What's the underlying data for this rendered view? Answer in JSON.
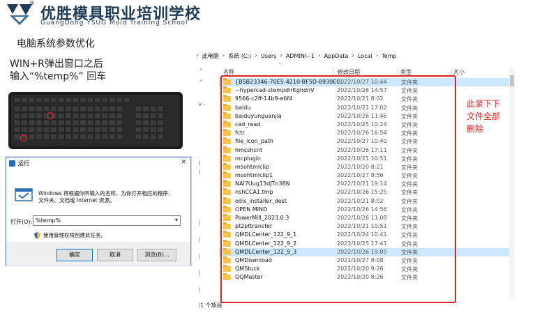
{
  "header": {
    "title": "优胜模具职业培训学校",
    "subtitle": "GuangDong YSUG Mold Training School",
    "registered_mark": "®"
  },
  "slide": {
    "heading": "电脑系统参数优化",
    "instruction_line1": "WIN+R弹出窗口之后",
    "instruction_line2": "输入“%temp%” 回车"
  },
  "run_dialog": {
    "title": "运行",
    "close_glyph": "✕",
    "description_line1": "Windows 将根据你所输入的名称，为你打开相应的程序、",
    "description_line2": "文件夹、文档或 Internet 资源。",
    "open_label": "打开(O):",
    "open_value": "%temp%",
    "admin_text": "使用管理权限创建此任务。",
    "buttons": [
      "确定",
      "取消",
      "浏览(B)..."
    ]
  },
  "explorer": {
    "breadcrumb": [
      "此电脑",
      "系统 (C:)",
      "Users",
      "ADMINI~1",
      "AppData",
      "Local",
      "Temp"
    ],
    "columns": [
      "名称",
      "修改日期",
      "类型",
      "大小"
    ],
    "nav_marks": [
      "^",
      "^",
      "x -",
      "(",
      "(",
      "|",
      "|",
      "|",
      "|",
      "|",
      "|"
    ],
    "files": [
      {
        "name": "{B5B23346-70E5-4210-BF5D-8930EC...",
        "date": "2022/10/27 10:44",
        "type": "文件夹",
        "selected": true
      },
      {
        "name": "~hypercad-stempdirKghdnV",
        "date": "2022/10/26 14:57",
        "type": "文件夹"
      },
      {
        "name": "9566-c2ff-14b9-e6f4",
        "date": "2022/10/21 8:02",
        "type": "文件夹"
      },
      {
        "name": "baidu",
        "date": "2022/10/21 17:02",
        "type": "文件夹"
      },
      {
        "name": "baiduyunguanjia",
        "date": "2022/10/26 11:46",
        "type": "文件夹"
      },
      {
        "name": "cad_read",
        "date": "2022/10/25 10:24",
        "type": "文件夹"
      },
      {
        "name": "fctr",
        "date": "2022/10/26 16:54",
        "type": "文件夹"
      },
      {
        "name": "file_icon_path",
        "date": "2022/10/27 10:40",
        "type": "文件夹"
      },
      {
        "name": "hmcshcnt",
        "date": "2022/10/26 17:11",
        "type": "文件夹"
      },
      {
        "name": "mcplugin",
        "date": "2022/10/21 10:51",
        "type": "文件夹"
      },
      {
        "name": "msohtmlclip",
        "date": "2022/10/20 8:21",
        "type": "文件夹"
      },
      {
        "name": "msohtmlclip1",
        "date": "2022/10/27 8:56",
        "type": "文件夹"
      },
      {
        "name": "NAI7Uug13dJTn38N",
        "date": "2022/10/21 19:14",
        "type": "文件夹"
      },
      {
        "name": "nshCCA1.tmp",
        "date": "2022/10/26 15:25",
        "type": "文件夹"
      },
      {
        "name": "odis_installer_dest",
        "date": "2022/10/21 8:02",
        "type": "文件夹"
      },
      {
        "name": "OPEN MIND",
        "date": "2022/10/26 14:56",
        "type": "文件夹"
      },
      {
        "name": "PowerMill_2023.0.3",
        "date": "2022/10/26 11:08",
        "type": "文件夹"
      },
      {
        "name": "pt2pttransfer",
        "date": "2022/10/21 10:51",
        "type": "文件夹"
      },
      {
        "name": "QMDLCenter_122_9_1",
        "date": "2022/10/24 10:41",
        "type": "文件夹"
      },
      {
        "name": "QMDLCenter_122_9_2",
        "date": "2022/10/25 17:41",
        "type": "文件夹"
      },
      {
        "name": "QMDLCenter_122_9_3",
        "date": "2022/10/26 19:05",
        "type": "文件夹",
        "selected": true
      },
      {
        "name": "QMDownload",
        "date": "2022/10/27 8:08",
        "type": "文件夹"
      },
      {
        "name": "QMStuck",
        "date": "2022/10/20 9:26",
        "type": "文件夹"
      },
      {
        "name": "QQMaster",
        "date": "2022/10/20 8:26",
        "type": "文件夹"
      }
    ],
    "status": "1 个项目"
  },
  "annotation": {
    "note_lines": [
      "此录下下",
      "文件全部",
      "删除"
    ],
    "color": "#e02020"
  },
  "colors": {
    "brand": "#1f3b57",
    "selection": "#cce8ff",
    "folder": "#f6c44f"
  }
}
